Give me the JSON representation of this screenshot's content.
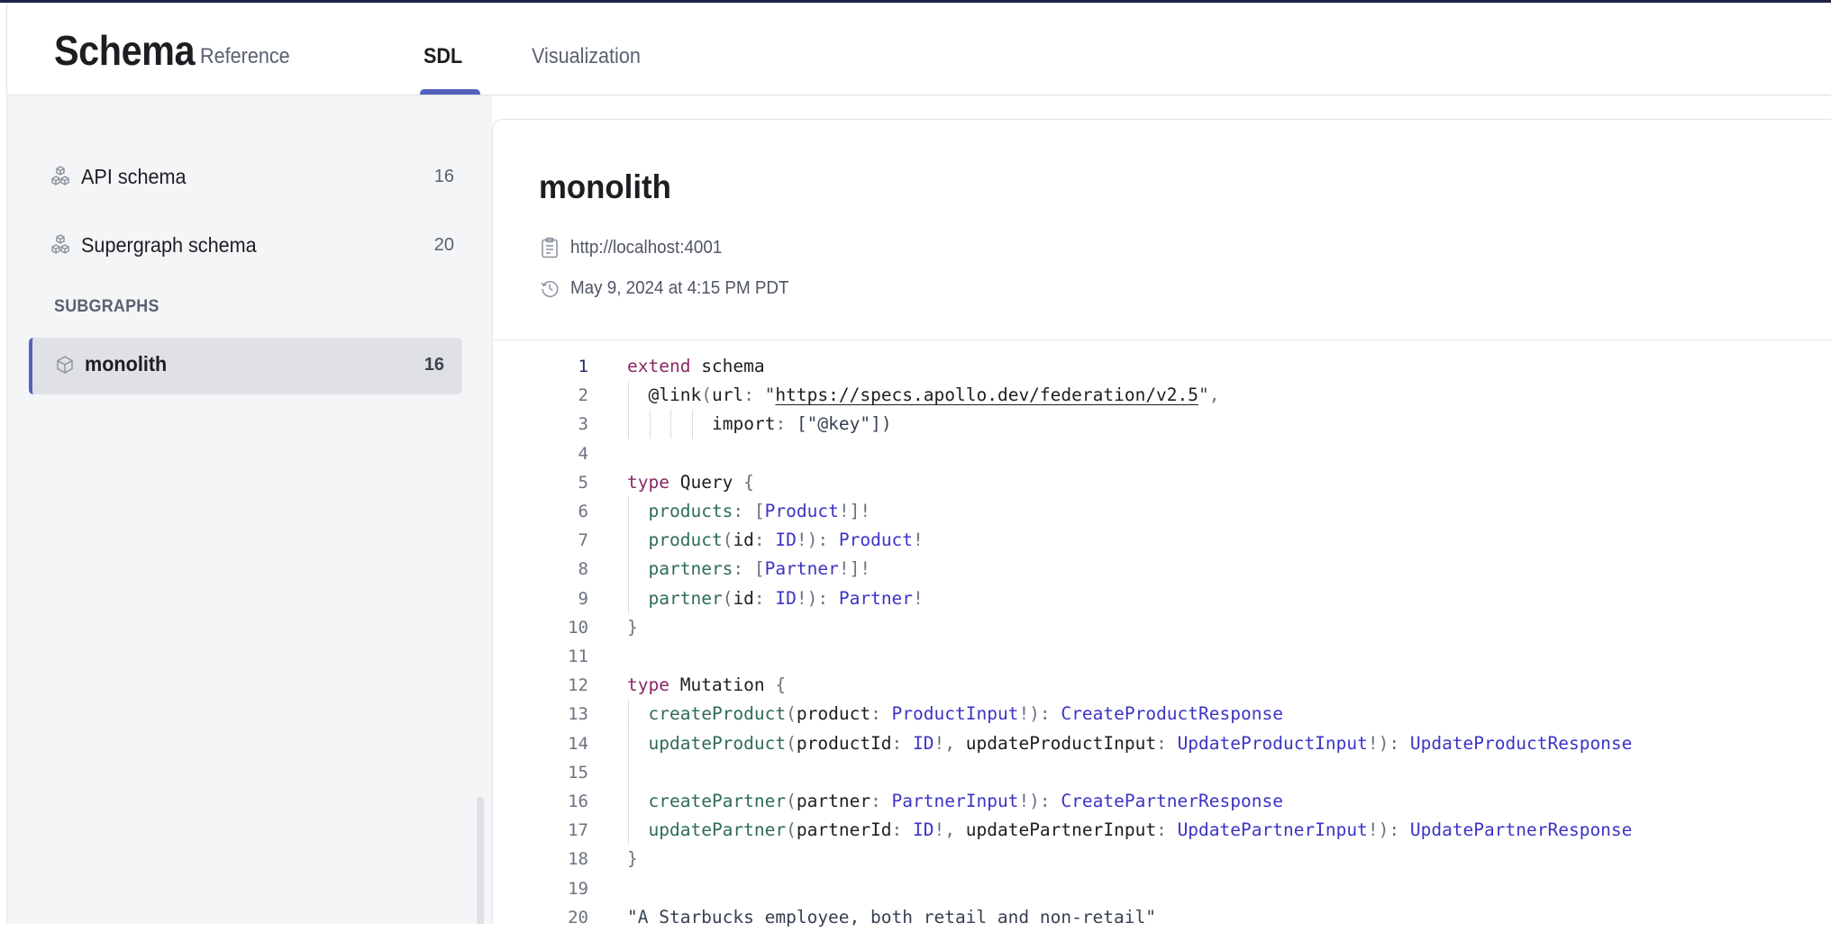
{
  "header": {
    "title": "Schema",
    "tabs": [
      {
        "label": "Reference",
        "active": false
      },
      {
        "label": "SDL",
        "active": true
      },
      {
        "label": "Visualization",
        "active": false
      }
    ],
    "accent_color": "#5360bd"
  },
  "sidebar": {
    "items": [
      {
        "label": "API schema",
        "count": "16",
        "icon": "cubes-icon"
      },
      {
        "label": "Supergraph schema",
        "count": "20",
        "icon": "cubes-icon"
      }
    ],
    "section_label": "SUBGRAPHS",
    "subgraphs": [
      {
        "label": "monolith",
        "count": "16",
        "icon": "cube-icon",
        "active": true
      }
    ]
  },
  "detail": {
    "title": "monolith",
    "url": "http://localhost:4001",
    "updated": "May 9, 2024 at 4:15 PM PDT"
  },
  "code": {
    "active_line": 1,
    "lines": [
      {
        "n": "1",
        "tokens": [
          [
            "kw",
            "extend"
          ],
          [
            "tn",
            " schema"
          ]
        ]
      },
      {
        "n": "2",
        "guides": 1,
        "indent": 1,
        "tokens": [
          [
            "ar",
            "@link"
          ],
          [
            "pu",
            "("
          ],
          [
            "ar",
            "url"
          ],
          [
            "pu",
            ": "
          ],
          [
            "st",
            "\""
          ],
          [
            "url",
            "https://specs.apollo.dev/federation/v2.5"
          ],
          [
            "st",
            "\""
          ],
          [
            "pu",
            ","
          ]
        ]
      },
      {
        "n": "3",
        "guides": 4,
        "indent": 4,
        "tokens": [
          [
            "ar",
            "import"
          ],
          [
            "pu",
            ": "
          ],
          [
            "st",
            "[\"@key\"])"
          ]
        ]
      },
      {
        "n": "4",
        "tokens": []
      },
      {
        "n": "5",
        "tokens": [
          [
            "kw",
            "type"
          ],
          [
            "tn",
            " Query "
          ],
          [
            "pu",
            "{"
          ]
        ]
      },
      {
        "n": "6",
        "guides": 1,
        "indent": 1,
        "tokens": [
          [
            "fd",
            "products"
          ],
          [
            "pu",
            ": ["
          ],
          [
            "ty",
            "Product"
          ],
          [
            "pu",
            "!]!"
          ]
        ]
      },
      {
        "n": "7",
        "guides": 1,
        "indent": 1,
        "tokens": [
          [
            "fd",
            "product"
          ],
          [
            "pu",
            "("
          ],
          [
            "ar",
            "id"
          ],
          [
            "pu",
            ": "
          ],
          [
            "ty",
            "ID"
          ],
          [
            "pu",
            "!): "
          ],
          [
            "ty",
            "Product"
          ],
          [
            "pu",
            "!"
          ]
        ]
      },
      {
        "n": "8",
        "guides": 1,
        "indent": 1,
        "tokens": [
          [
            "fd",
            "partners"
          ],
          [
            "pu",
            ": ["
          ],
          [
            "ty",
            "Partner"
          ],
          [
            "pu",
            "!]!"
          ]
        ]
      },
      {
        "n": "9",
        "guides": 1,
        "indent": 1,
        "tokens": [
          [
            "fd",
            "partner"
          ],
          [
            "pu",
            "("
          ],
          [
            "ar",
            "id"
          ],
          [
            "pu",
            ": "
          ],
          [
            "ty",
            "ID"
          ],
          [
            "pu",
            "!): "
          ],
          [
            "ty",
            "Partner"
          ],
          [
            "pu",
            "!"
          ]
        ]
      },
      {
        "n": "10",
        "tokens": [
          [
            "pu",
            "}"
          ]
        ]
      },
      {
        "n": "11",
        "tokens": []
      },
      {
        "n": "12",
        "tokens": [
          [
            "kw",
            "type"
          ],
          [
            "tn",
            " Mutation "
          ],
          [
            "pu",
            "{"
          ]
        ]
      },
      {
        "n": "13",
        "guides": 1,
        "indent": 1,
        "tokens": [
          [
            "fd",
            "createProduct"
          ],
          [
            "pu",
            "("
          ],
          [
            "ar",
            "product"
          ],
          [
            "pu",
            ": "
          ],
          [
            "ty",
            "ProductInput"
          ],
          [
            "pu",
            "!): "
          ],
          [
            "ty",
            "CreateProductResponse"
          ]
        ]
      },
      {
        "n": "14",
        "guides": 1,
        "indent": 1,
        "tokens": [
          [
            "fd",
            "updateProduct"
          ],
          [
            "pu",
            "("
          ],
          [
            "ar",
            "productId"
          ],
          [
            "pu",
            ": "
          ],
          [
            "ty",
            "ID"
          ],
          [
            "pu",
            "!, "
          ],
          [
            "ar",
            "updateProductInput"
          ],
          [
            "pu",
            ": "
          ],
          [
            "ty",
            "UpdateProductInput"
          ],
          [
            "pu",
            "!): "
          ],
          [
            "ty",
            "UpdateProductResponse"
          ]
        ]
      },
      {
        "n": "15",
        "guides": 1,
        "tokens": []
      },
      {
        "n": "16",
        "guides": 1,
        "indent": 1,
        "tokens": [
          [
            "fd",
            "createPartner"
          ],
          [
            "pu",
            "("
          ],
          [
            "ar",
            "partner"
          ],
          [
            "pu",
            ": "
          ],
          [
            "ty",
            "PartnerInput"
          ],
          [
            "pu",
            "!): "
          ],
          [
            "ty",
            "CreatePartnerResponse"
          ]
        ]
      },
      {
        "n": "17",
        "guides": 1,
        "indent": 1,
        "tokens": [
          [
            "fd",
            "updatePartner"
          ],
          [
            "pu",
            "("
          ],
          [
            "ar",
            "partnerId"
          ],
          [
            "pu",
            ": "
          ],
          [
            "ty",
            "ID"
          ],
          [
            "pu",
            "!, "
          ],
          [
            "ar",
            "updatePartnerInput"
          ],
          [
            "pu",
            ": "
          ],
          [
            "ty",
            "UpdatePartnerInput"
          ],
          [
            "pu",
            "!): "
          ],
          [
            "ty",
            "UpdatePartnerResponse"
          ]
        ]
      },
      {
        "n": "18",
        "tokens": [
          [
            "pu",
            "}"
          ]
        ]
      },
      {
        "n": "19",
        "tokens": []
      },
      {
        "n": "20",
        "tokens": [
          [
            "st",
            "\"A Starbucks employee, both retail and non-retail\""
          ]
        ]
      }
    ]
  }
}
